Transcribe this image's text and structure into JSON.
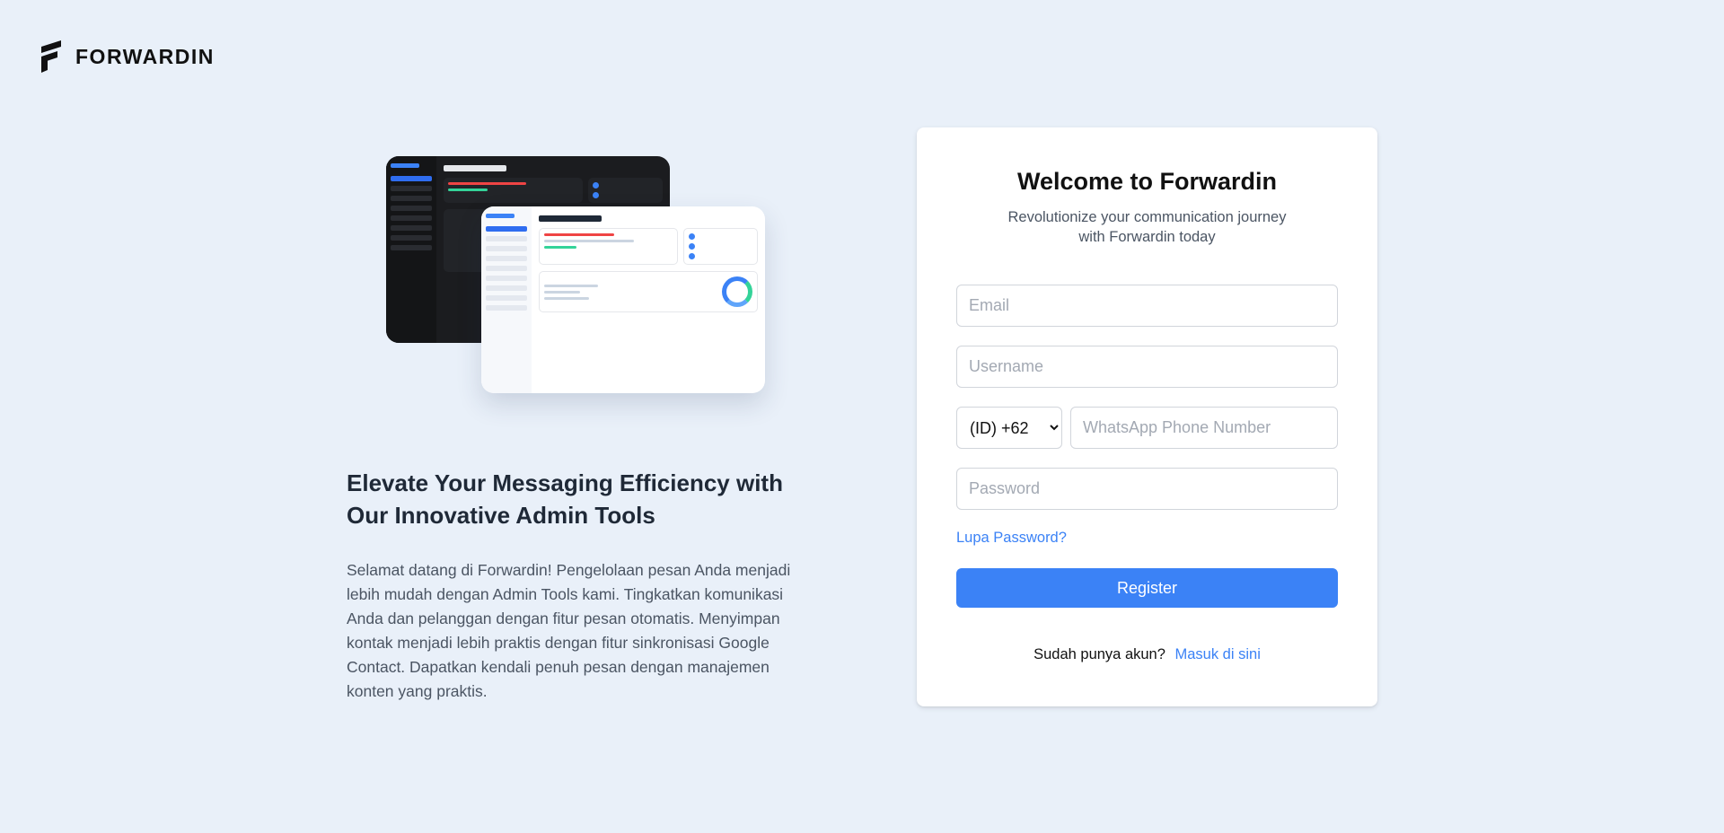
{
  "brand": {
    "name": "FORWARDIN",
    "logo_icon": "forwardin-logo-icon"
  },
  "hero": {
    "heading_line1": "Elevate Your Messaging Efficiency with",
    "heading_line2": "Our Innovative Admin Tools",
    "description": "Selamat datang di Forwardin! Pengelolaan pesan Anda menjadi lebih mudah dengan Admin Tools kami. Tingkatkan komunikasi Anda dan pelanggan dengan fitur pesan otomatis. Menyimpan kontak menjadi lebih praktis dengan fitur sinkronisasi Google Contact. Dapatkan kendali penuh pesan dengan manajemen konten yang praktis."
  },
  "form": {
    "title": "Welcome to Forwardin",
    "subtitle": "Revolutionize your communication journey with Forwardin today",
    "email_placeholder": "Email",
    "username_placeholder": "Username",
    "country_code_selected": "(ID) +62",
    "phone_placeholder": "WhatsApp Phone Number",
    "password_placeholder": "Password",
    "forgot_password_label": "Lupa Password?",
    "register_label": "Register",
    "login_prompt": "Sudah punya akun?",
    "login_link_label": "Masuk di sini"
  },
  "colors": {
    "background": "#e9f0f9",
    "accent": "#3b82f6",
    "card": "#ffffff"
  }
}
